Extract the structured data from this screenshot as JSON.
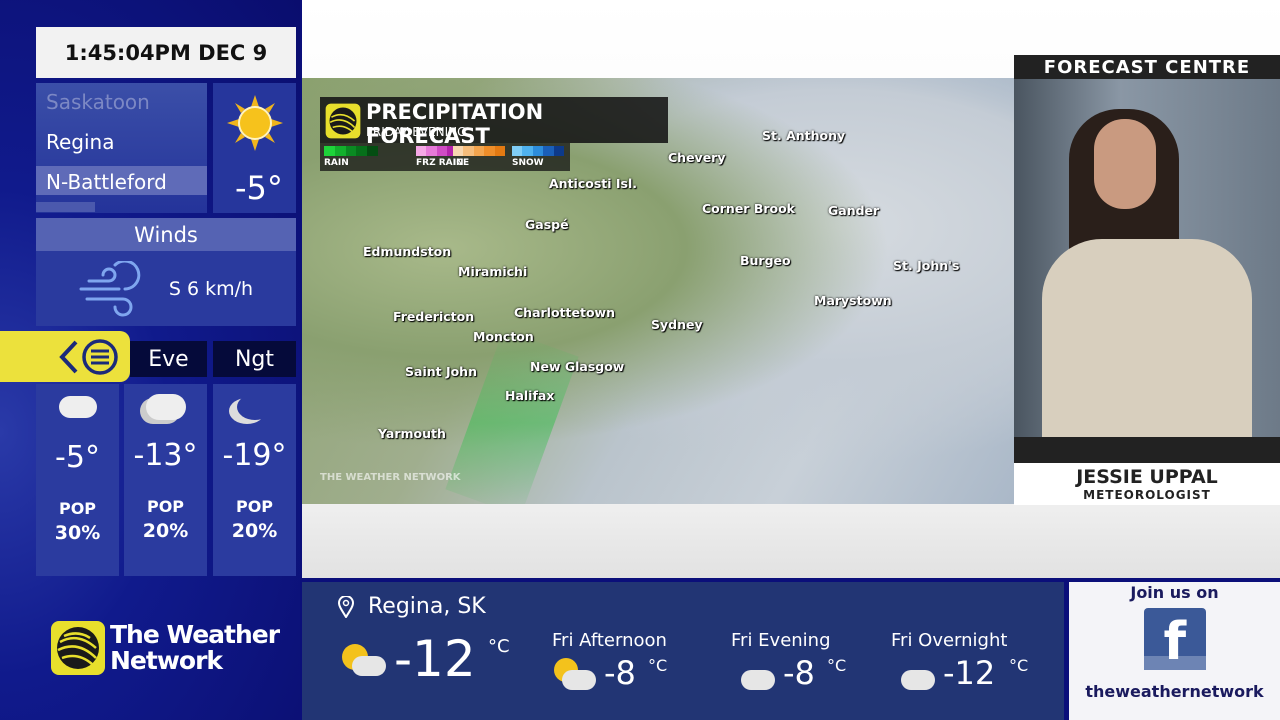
{
  "clock": "1:45:04PM DEC 9",
  "cities": [
    "Saskatoon",
    "Regina",
    "N-Battleford"
  ],
  "current": {
    "icon": "sun-icon",
    "temp": "-5°"
  },
  "winds": {
    "label": "Winds",
    "value": "S 6 km/h",
    "icon": "wind-icon"
  },
  "periods": [
    {
      "label": "Eve",
      "icon": "cloudy-icon",
      "temp": "-5°",
      "pop_label": "POP",
      "pop": "30%"
    },
    {
      "label": "Eve",
      "icon": "cloudy-night-icon",
      "temp": "-13°",
      "pop_label": "POP",
      "pop": "20%"
    },
    {
      "label": "Ngt",
      "icon": "partly-cloudy-night-icon",
      "temp": "-19°",
      "pop_label": "POP",
      "pop": "20%"
    }
  ],
  "logo": {
    "line1": "The Weather",
    "line2": "Network"
  },
  "map": {
    "title": "PRECIPITATION FORECAST",
    "subtitle": "FRIDAY EVENING",
    "legend": [
      {
        "label": "RAIN",
        "colors": [
          "#1ed43a",
          "#12b02c",
          "#0a8a22",
          "#06701a",
          "#044d12"
        ]
      },
      {
        "label": "FRZ RAIN",
        "colors": [
          "#f5a8e6",
          "#e67ad8",
          "#d04cc4",
          "#b423ab",
          "#8a1286"
        ]
      },
      {
        "label": "ICE",
        "colors": [
          "#f8d7b0",
          "#f5bd7c",
          "#f2a54f",
          "#ee8e2a",
          "#e37a12"
        ]
      },
      {
        "label": "SNOW",
        "colors": [
          "#7fcdf5",
          "#4fb2ee",
          "#2d8ddb",
          "#1a5fb8",
          "#0d3a8a"
        ]
      }
    ],
    "places": [
      "St. Anthony",
      "Chevery",
      "Anticosti Isl.",
      "Corner Brook",
      "Gander",
      "Gaspé",
      "Edmundston",
      "Burgeo",
      "St. John's",
      "Miramichi",
      "Marystown",
      "Fredericton",
      "Charlottetown",
      "Sydney",
      "Moncton",
      "New Glasgow",
      "Saint John",
      "Halifax",
      "Yarmouth"
    ],
    "watermark": "THE WEATHER NETWORK"
  },
  "presenter": {
    "section": "FORECAST CENTRE",
    "name": "JESSIE UPPAL",
    "title": "METEOROLOGIST"
  },
  "bottom": {
    "location": "Regina, SK",
    "current_temp": "-12",
    "unit": "°C",
    "forecast": [
      {
        "label": "Fri Afternoon",
        "temp": "-8",
        "icon": "partly-sunny-icon"
      },
      {
        "label": "Fri Evening",
        "temp": "-8",
        "icon": "cloudy-night-icon"
      },
      {
        "label": "Fri Overnight",
        "temp": "-12",
        "icon": "partly-cloudy-night-icon"
      }
    ]
  },
  "social": {
    "join": "Join us on",
    "handle": "theweathernetwork",
    "icon": "facebook-icon"
  }
}
